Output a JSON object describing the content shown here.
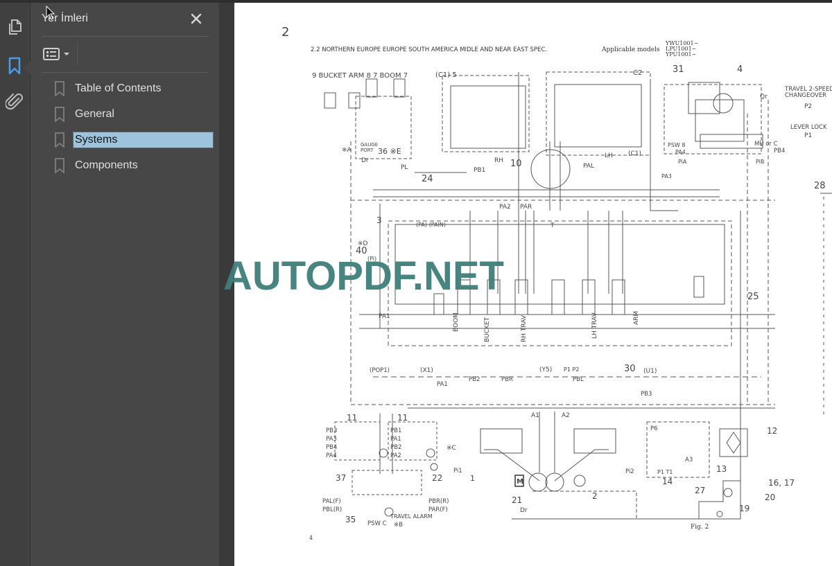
{
  "sidebar": {
    "rail": {
      "items": [
        {
          "name": "pages-thumbnails",
          "icon": "pages-icon",
          "active": false
        },
        {
          "name": "bookmarks",
          "icon": "bookmark-icon",
          "active": true
        },
        {
          "name": "attachments",
          "icon": "paperclip-icon",
          "active": false
        }
      ],
      "active_color": "#4a9be8"
    },
    "panel": {
      "title": "Yer İmleri",
      "close_icon": "close-icon",
      "options_icon": "bookmark-options-icon",
      "bookmarks": [
        {
          "label": "Table of Contents",
          "selected": false
        },
        {
          "label": "General",
          "selected": false
        },
        {
          "label": "Systems",
          "selected": true
        },
        {
          "label": "Components",
          "selected": false
        }
      ],
      "selection_color": "#9ec4dd"
    }
  },
  "document": {
    "page_number_handwritten": "2",
    "section_heading": "2.2  NORTHERN EUROPE  EUROPE  SOUTH AMERICA  MIDLE AND NEAR EAST  SPEC.",
    "applicable_models_label": "Applicable models",
    "models": [
      "YWU1001~",
      "LPU1001~",
      "YPU1001~"
    ],
    "figure_caption": "Fig. 2",
    "footer_page": "4",
    "schematic_labels": {
      "top_left": "9 BUCKET  ARM 8  7   BOOM  7",
      "c1_5": "(C1)  5",
      "c2_top": "C2",
      "n31": "31",
      "n4": "4",
      "travel_2speed": "TRAVEL  2-SPEED",
      "changeover": "CHANGEOVER",
      "p2": "P2",
      "lever_lock": "LEVER  LOCK",
      "p1": "P1",
      "qr": "Qr",
      "gauge": "GAUGE",
      "port": "PORT",
      "n36e": "36 ※E",
      "xa": "※A",
      "dr": "Dr",
      "pl": "PL",
      "n24": "24",
      "pb1": "PB1",
      "rh": "RH",
      "n10": "10",
      "pal": "PAL",
      "lh": "LH",
      "c1b": "(C1)",
      "psw8": "PSW  8",
      "pa4": "PA4",
      "pia": "PiA",
      "pa3": "PA3",
      "muorc": "MU or C",
      "pb4": "PB4",
      "pib": "PiB",
      "n28": "28",
      "n3": "3",
      "pa_pain": "(PA)  (PAIN)",
      "xd": "※D",
      "n40": "40",
      "pi_paren": "(Pi)",
      "pa2": "PA2",
      "par": "PAR",
      "t": "T",
      "n25": "25",
      "pa1": "PA1",
      "boom": "BOOM",
      "bucket": "BUCKET",
      "rh_trav": "RH  TRAV",
      "lh_trav": "LH  TRAV",
      "arm": "ARM",
      "pop1": "(POP1)",
      "x1": "(X1)",
      "y5": "(Y5)",
      "p1p2": "P1  P2",
      "u1": "(U1)",
      "n30": "30",
      "pb2": "PB2",
      "pbr": "PBR",
      "pbl": "PBL",
      "pa1b": "PA1",
      "pb3": "PB3",
      "a1": "A1",
      "a2": "A2",
      "n11a": "11",
      "n11b": "11",
      "left_ports": [
        "PB3",
        "PA3",
        "PB4",
        "PA4"
      ],
      "mid_ports": [
        "PB1",
        "PA1",
        "PB2",
        "PA2"
      ],
      "xc": "※C",
      "pi1": "Pi1",
      "n1": "1",
      "n37": "37",
      "n22": "22",
      "pal_f": "PAL(F)",
      "pbl_r": "PBL(R)",
      "pbr_r": "PBR(R)",
      "par_f": "PAR(F)",
      "n35": "35",
      "psw_c": "PSW  C",
      "travel_alarm": "TRAVEL  ALARM",
      "xb": "※B",
      "m": "M",
      "n21": "21",
      "n2": "2",
      "dr2": "Dr",
      "pi2": "Pi2",
      "p6": "P6",
      "a3": "A3",
      "p1t1": "P1   T1",
      "n14": "14",
      "n12": "12",
      "n13": "13",
      "n27": "27",
      "n16_17": "16, 17",
      "n20": "20",
      "n19": "19"
    }
  },
  "watermark": {
    "text": "AUTOPDF.NET",
    "color": "#3f7f7a"
  }
}
